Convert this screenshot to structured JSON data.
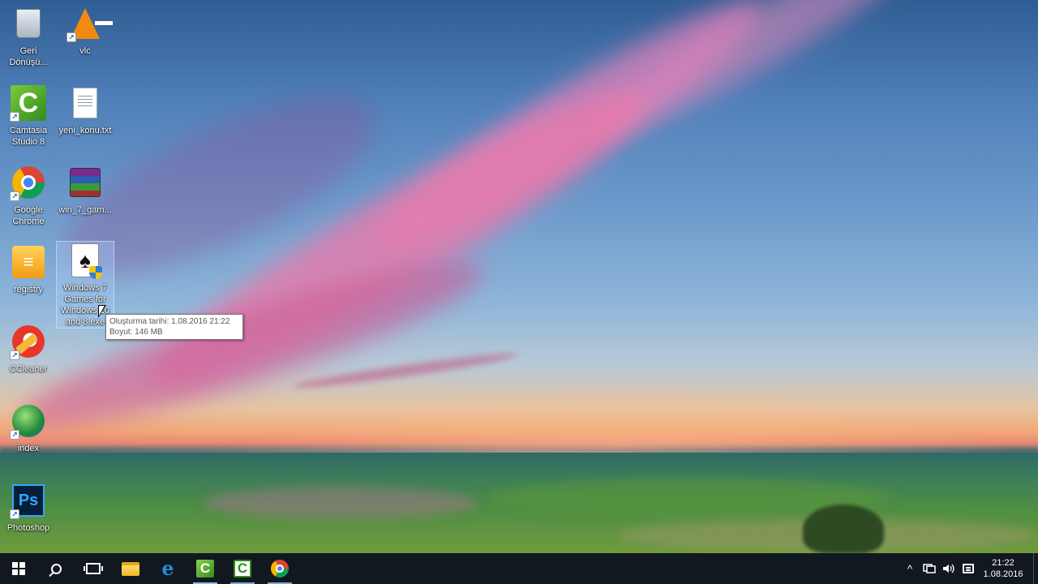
{
  "desktop_icons": [
    {
      "id": "recycle-bin",
      "label": "Geri Dönüşü...",
      "icon": "recycle-bin-icon",
      "shortcut": false
    },
    {
      "id": "vlc",
      "label": "vlc",
      "icon": "vlc-icon",
      "shortcut": true
    },
    {
      "id": "camtasia",
      "label": "Camtasia Studio 8",
      "icon": "camtasia-icon",
      "shortcut": true
    },
    {
      "id": "text-file",
      "label": "yeni_konu.txt",
      "icon": "text-file-icon",
      "shortcut": false
    },
    {
      "id": "chrome",
      "label": "Google Chrome",
      "icon": "chrome-icon",
      "shortcut": true
    },
    {
      "id": "rar-archive",
      "label": "win_7_gam...",
      "icon": "winrar-archive-icon",
      "shortcut": false
    },
    {
      "id": "registry",
      "label": "registry",
      "icon": "registry-icon",
      "shortcut": false
    },
    {
      "id": "win7-games",
      "label": "Windows 7 Games for Windows 10 and 8.exe",
      "icon": "solitaire-cards-icon",
      "shortcut": false,
      "selected": true
    },
    {
      "id": "ccleaner",
      "label": "CCleaner",
      "icon": "ccleaner-icon",
      "shortcut": true
    },
    {
      "id": "index",
      "label": "index",
      "icon": "globe-icon",
      "shortcut": true
    },
    {
      "id": "photoshop",
      "label": "Photoshop",
      "icon": "photoshop-icon",
      "shortcut": true
    }
  ],
  "tooltip": {
    "line1": "Oluşturma tarihi: 1.08.2016 21:22",
    "line2": "Boyut: 146 MB"
  },
  "taskbar": {
    "start_icon": "windows-logo-icon",
    "search_icon": "search-icon",
    "taskview_icon": "task-view-icon",
    "pinned": [
      {
        "name": "file-explorer",
        "icon": "folder-icon"
      },
      {
        "name": "edge",
        "icon": "edge-icon",
        "glyph": "e"
      },
      {
        "name": "camtasia-studio",
        "icon": "camtasia-icon",
        "glyph": "C",
        "state": "active"
      },
      {
        "name": "camtasia-recorder",
        "icon": "camtasia-recorder-icon",
        "glyph": "C",
        "state": "open"
      },
      {
        "name": "chrome",
        "icon": "chrome-icon",
        "state": "open"
      }
    ]
  },
  "tray": {
    "chevron": "^",
    "network_icon": "network-icon",
    "volume_icon": "volume-icon",
    "notification_icon": "action-center-icon",
    "time": "21:22",
    "date": "1.08.2016"
  },
  "colors": {
    "taskbar_bg": "#101216",
    "selection_bg": "#aad2ff",
    "tooltip_text": "#575757"
  }
}
